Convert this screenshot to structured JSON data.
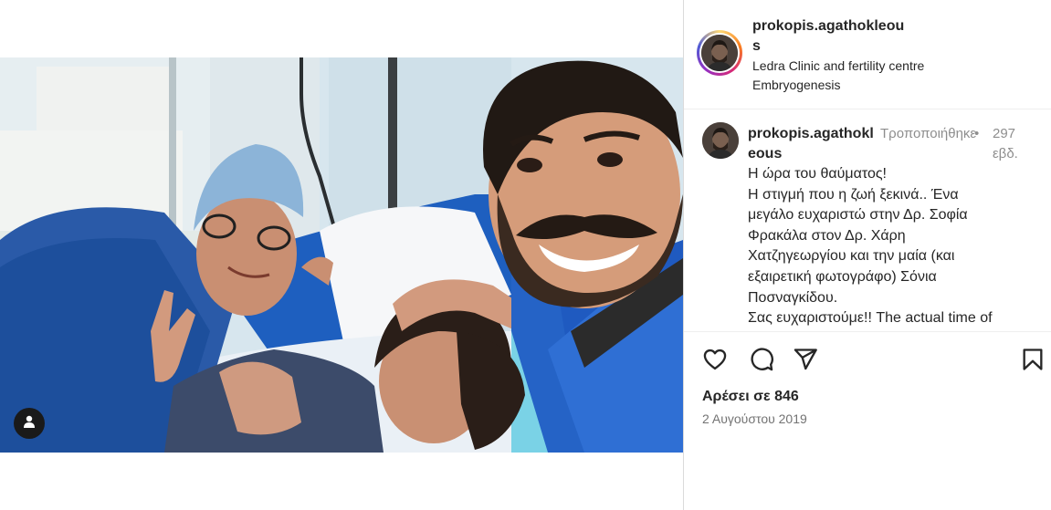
{
  "post": {
    "media": {
      "user_tags_icon": "user-tag-icon"
    },
    "header": {
      "username": "prokopis.agathokleous",
      "location_line1": "Ledra Clinic and fertility centre",
      "location_line2": "Embryogenesis"
    },
    "caption": {
      "username": "prokopis.agathokleous",
      "edited_label": "Τροποποιήθηκε",
      "separator": "•",
      "time_ago": "297 εβδ.",
      "lines": [
        "Η ώρα του θαύματος!",
        "Η στιγμή που η ζωή ξεκινά.. Ένα",
        "μεγάλο ευχαριστώ στην Δρ. Σοφία",
        "Φρακάλα στον Δρ. Χάρη",
        "Χατζηγεωργίου και την μαία (και",
        "εξαιρετική φωτογράφο) Σόνια",
        "Ποσναγκίδου.",
        "Σας ευχαριστούμε!! The actual time of"
      ]
    },
    "actions": {
      "like_icon": "heart-icon",
      "comment_icon": "comment-icon",
      "share_icon": "paper-plane-icon",
      "save_icon": "bookmark-icon"
    },
    "likes_text": "Αρέσει σε 846",
    "date_text": "2 Αυγούστου 2019"
  }
}
